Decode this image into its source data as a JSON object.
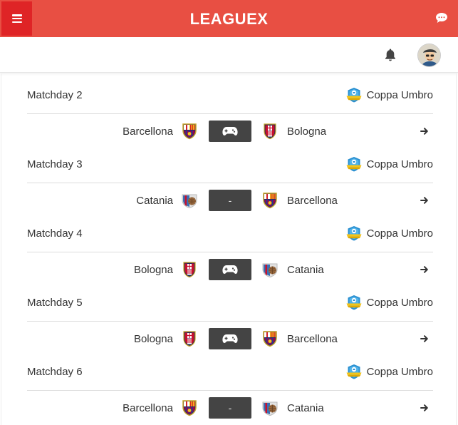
{
  "header": {
    "title": "LEAGUEX",
    "menu_icon": "hamburger-icon",
    "chat_icon": "chat-bubble-icon"
  },
  "subheader": {
    "bell_icon": "bell-icon",
    "avatar_icon": "user-avatar"
  },
  "colors": {
    "brand": "#e84f43",
    "menu": "#df2426",
    "score_box": "#444444"
  },
  "matchdays": [
    {
      "label": "Matchday 2",
      "competition": "Coppa Umbro",
      "home": "Barcellona",
      "away": "Bologna",
      "score": "",
      "score_icon": "gamepad-icon"
    },
    {
      "label": "Matchday 3",
      "competition": "Coppa Umbro",
      "home": "Catania",
      "away": "Barcellona",
      "score": "-",
      "score_icon": ""
    },
    {
      "label": "Matchday 4",
      "competition": "Coppa Umbro",
      "home": "Bologna",
      "away": "Catania",
      "score": "",
      "score_icon": "gamepad-icon"
    },
    {
      "label": "Matchday 5",
      "competition": "Coppa Umbro",
      "home": "Bologna",
      "away": "Barcellona",
      "score": "",
      "score_icon": "gamepad-icon"
    },
    {
      "label": "Matchday 6",
      "competition": "Coppa Umbro",
      "home": "Barcellona",
      "away": "Catania",
      "score": "-",
      "score_icon": ""
    }
  ]
}
